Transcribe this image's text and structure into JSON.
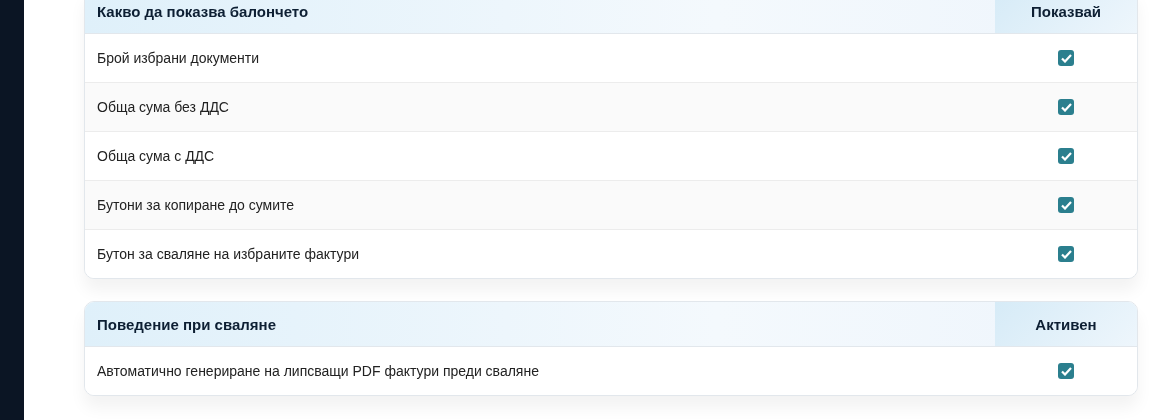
{
  "sections": [
    {
      "title": "Какво да показва балончето",
      "column": "Показвай",
      "rows": [
        {
          "label": "Брой избрани документи",
          "checked": true
        },
        {
          "label": "Обща сума без ДДС",
          "checked": true
        },
        {
          "label": "Обща сума с ДДС",
          "checked": true
        },
        {
          "label": "Бутони за копиране до сумите",
          "checked": true
        },
        {
          "label": "Бутон за сваляне на избраните фактури",
          "checked": true
        }
      ]
    },
    {
      "title": "Поведение при сваляне",
      "column": "Активен",
      "rows": [
        {
          "label": "Автоматично генериране на липсващи PDF фактури преди сваляне",
          "checked": true
        }
      ]
    }
  ]
}
